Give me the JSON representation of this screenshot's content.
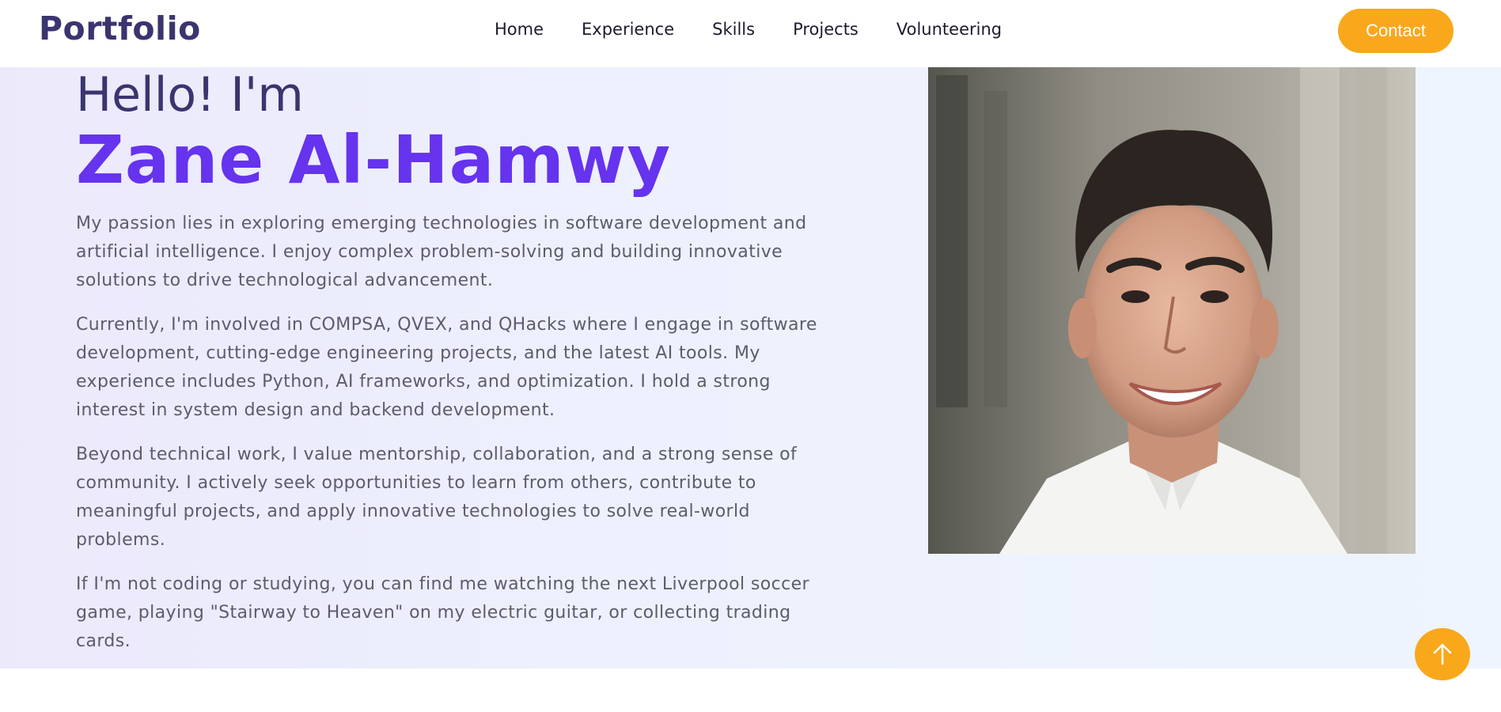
{
  "header": {
    "logo": "Portfolio",
    "nav": [
      "Home",
      "Experience",
      "Skills",
      "Projects",
      "Volunteering"
    ],
    "contact_label": "Contact"
  },
  "hero": {
    "greeting": "Hello! I'm",
    "name": "Zane Al-Hamwy",
    "paragraphs": [
      "My passion lies in exploring emerging technologies in software development and artificial intelligence. I enjoy complex problem-solving and building innovative solutions to drive technological advancement.",
      "Currently, I'm involved in COMPSA, QVEX, and QHacks where I engage in software development, cutting-edge engineering projects, and the latest AI tools. My experience includes Python, AI frameworks, and optimization. I hold a strong interest in system design and backend development.",
      "Beyond technical work, I value mentorship, collaboration, and a strong sense of community. I actively seek opportunities to learn from others, contribute to meaningful projects, and apply innovative technologies to solve real-world problems.",
      "If I'm not coding or studying, you can find me watching the next Liverpool soccer game, playing \"Stairway to Heaven\" on my electric guitar, or collecting trading cards."
    ]
  },
  "scroll_top_icon": "arrow-up-icon",
  "colors": {
    "brand": "#3a3470",
    "accent": "#f9a81b",
    "name": "#6633ee"
  }
}
